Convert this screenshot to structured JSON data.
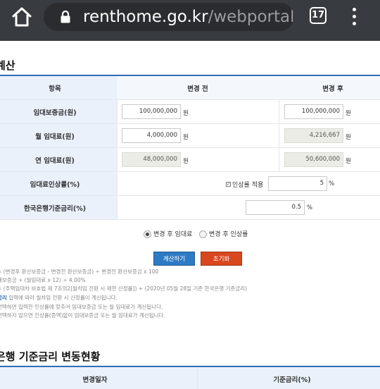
{
  "browser": {
    "url_host": "renthome.go.kr",
    "url_path": "/webportal/r",
    "tab_count": "17",
    "icons": [
      "home-icon",
      "lock-icon",
      "more-vert-icon"
    ]
  },
  "calculator": {
    "title": "계산",
    "headers": {
      "item": "항목",
      "before": "변경 전",
      "after": "변경 후"
    },
    "rows": {
      "deposit": {
        "label": "임대보증금(원)",
        "before": "100,000,000",
        "after": "100,000,000",
        "unit": "원"
      },
      "monthly": {
        "label": "월 임대료(원)",
        "before": "4,000,000",
        "after": "4,216,667",
        "unit": "원"
      },
      "annual": {
        "label": "연 임대료(원)",
        "before": "48,000,000",
        "after": "50,600,000",
        "unit": "원"
      },
      "increase": {
        "label": "임대료인상률(%)",
        "checkbox_label": "인상률 적용",
        "value": "5",
        "unit": "%"
      },
      "bok_rate": {
        "label": "한국은행기준금리(%)",
        "value": "0.5",
        "unit": "%"
      }
    },
    "radio": {
      "option1": "변경 후 임대료",
      "option2": "변경 후 인상률",
      "selected": "option1"
    },
    "buttons": {
      "calculate": "계산하기",
      "reset": "초기화"
    },
    "notes": [
      "= (변경후 환산보증금 - 변경전 환산보증금) ÷ 변경전 환산보증금 x 100",
      "대보증금 + (월임대료 x 12) ÷ 4.00%",
      "= (주택임대차 보호법 제 7조의2[월차임 전환 시 제한 산정률]) + (2020년 05월 28일 기준 한국은행 기준금리)",
      "입력에 따라 월차임 전환 시 산정률이 계산됩니다.",
      "선택하면 입력한 인상률에 맞추어 임대보증금 또는 월 임대료가 계산됩니다.",
      "선택하지 않으면 인상률(증액)없이 임대보증금 또는 월 임대료가 계산됩니다."
    ],
    "note_link": "금리"
  },
  "rate_history": {
    "title": "은행 기준금리 변동현황",
    "headers": {
      "date": "변경일자",
      "rate": "기준금리(%)"
    }
  },
  "colors": {
    "accent": "#2f6fb4",
    "calc_button": "#2d7bc5",
    "reset_button": "#d8471e",
    "label_bg": "#eaf1fb"
  }
}
